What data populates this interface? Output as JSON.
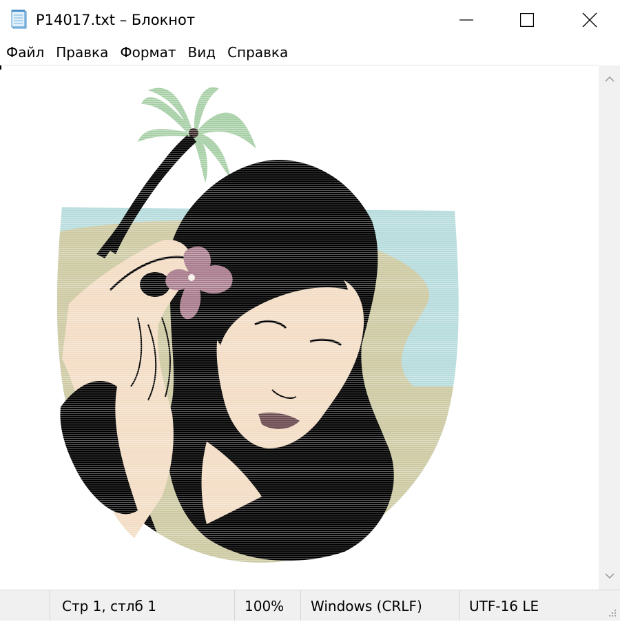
{
  "window": {
    "title": "P14017.txt – Блокнот",
    "icon": "notepad-icon"
  },
  "controls": {
    "minimize_icon": "minimize-icon",
    "maximize_icon": "maximize-icon",
    "close_icon": "close-icon"
  },
  "menu": {
    "items": [
      {
        "label": "Файл"
      },
      {
        "label": "Правка"
      },
      {
        "label": "Формат"
      },
      {
        "label": "Вид"
      },
      {
        "label": "Справка"
      }
    ]
  },
  "document": {
    "content_description_icon": "ascii-art-image",
    "colors": {
      "palm": "#a7cfa6",
      "sky": "#b6dbdc",
      "sand": "#cdc9a2",
      "skin": "#f3dcc4",
      "hair": "#000000",
      "flower": "#a87b8c"
    }
  },
  "scrollbar": {
    "up_icon": "chevron-up-icon",
    "down_icon": "chevron-down-icon"
  },
  "status": {
    "position": "Стр 1, стлб 1",
    "zoom": "100%",
    "line_endings": "Windows (CRLF)",
    "encoding": "UTF-16 LE"
  }
}
